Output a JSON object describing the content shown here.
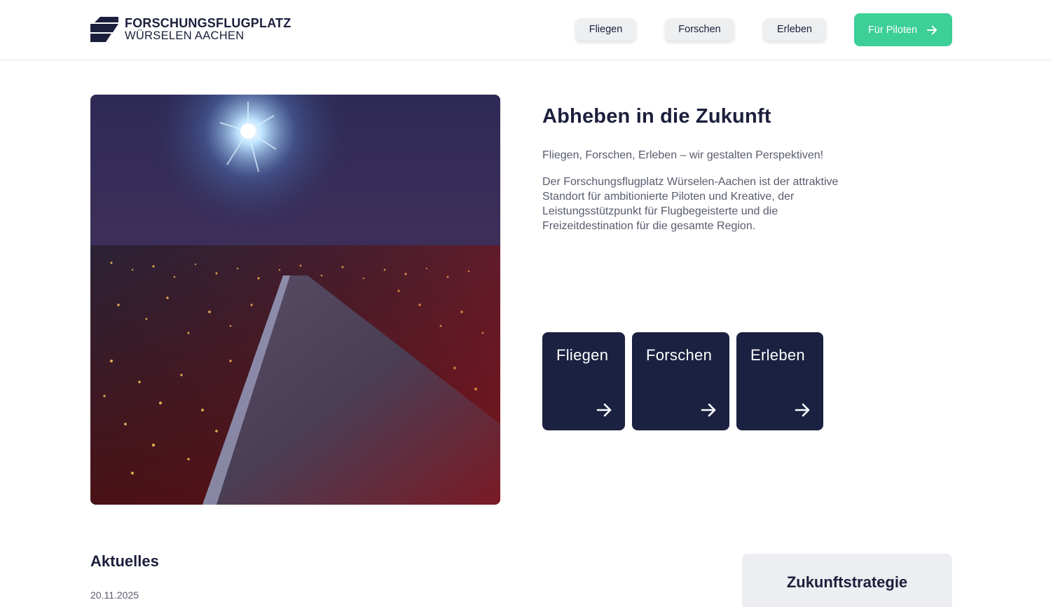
{
  "logo": {
    "line1": "FORSCHUNGSFLUGPLATZ",
    "line2": "WÜRSELEN AACHEN"
  },
  "nav": {
    "items": [
      {
        "label": "Fliegen"
      },
      {
        "label": "Forschen"
      },
      {
        "label": "Erleben"
      }
    ],
    "cta_label": "Für Piloten",
    "cta_color": "#3ccf97"
  },
  "hero": {
    "title": "Abheben in die Zukunft",
    "subtitle": "Fliegen, Forschen, Erleben – wir gestalten Perspektiven!",
    "body": "Der Forschungsflugplatz Würselen-Aachen ist der attraktive Standort für ambitionierte Piloten und Kreative, der Leistungsstützpunkt für Flugbegeisterte und die Freizeitdestination für die gesamte Region."
  },
  "tiles": [
    {
      "label": "Fliegen"
    },
    {
      "label": "Forschen"
    },
    {
      "label": "Erleben"
    }
  ],
  "news": {
    "title": "Aktuelles",
    "date": "20.11.2025"
  },
  "sidebar": {
    "title": "Zukunftstrategie"
  },
  "colors": {
    "navy": "#1b2140",
    "text": "#1b1f3b",
    "muted": "#585b6e",
    "accent": "#3ccf97"
  }
}
